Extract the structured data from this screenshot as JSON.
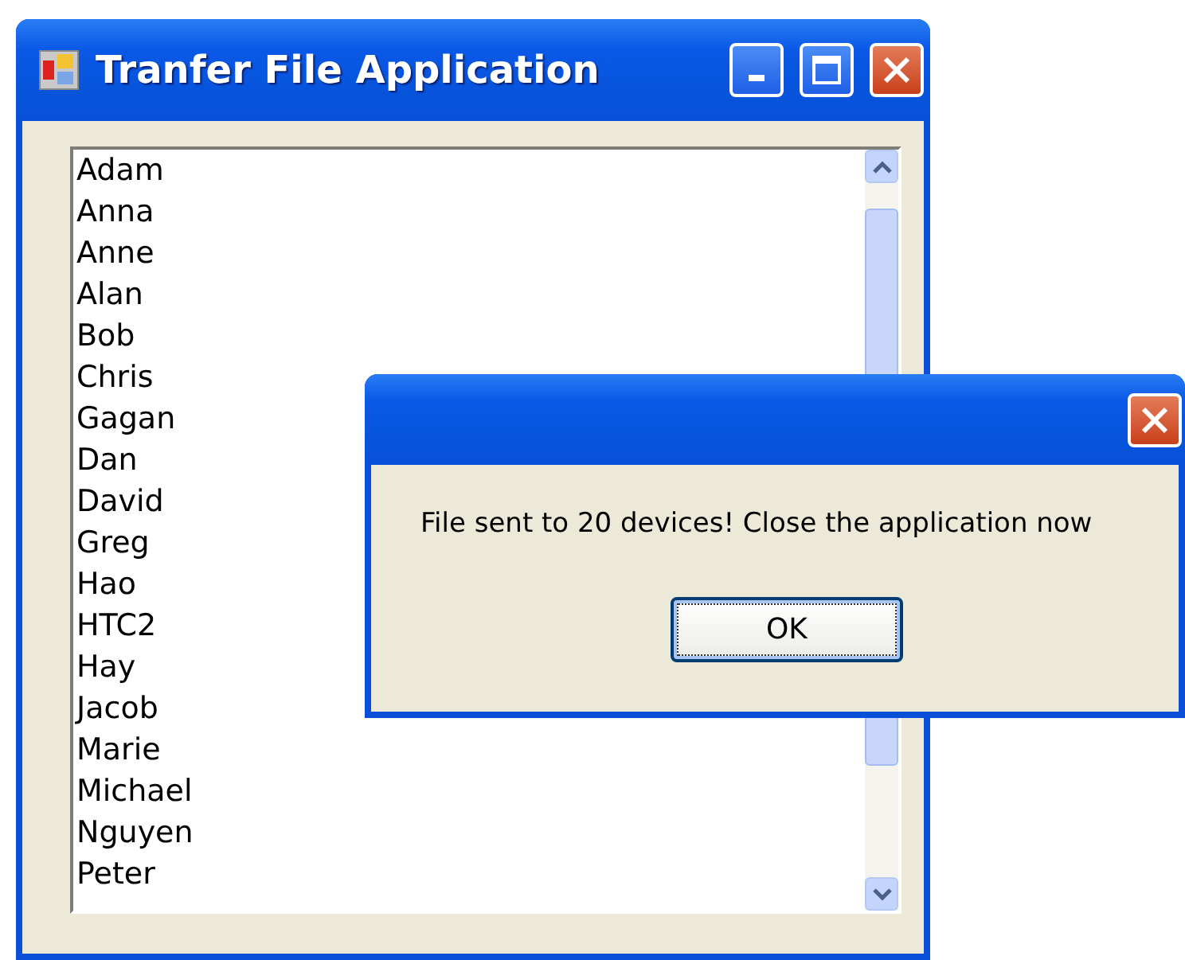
{
  "window": {
    "title": "Tranfer File Application"
  },
  "list": {
    "items": [
      "Adam",
      "Anna",
      "Anne",
      "Alan",
      "Bob",
      "Chris",
      "Gagan",
      "Dan",
      "David",
      "Greg",
      "Hao",
      "HTC2",
      "Hay",
      "Jacob",
      "Marie",
      "Michael",
      "Nguyen",
      "Peter"
    ]
  },
  "dialog": {
    "message": "File sent to 20 devices! Close the application now",
    "buttons": [
      {
        "label": "OK",
        "selected": true
      }
    ]
  }
}
